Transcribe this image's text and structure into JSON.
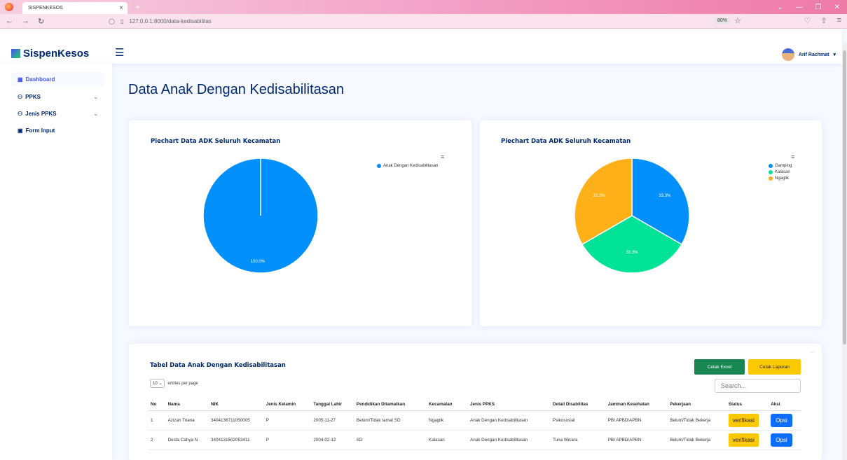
{
  "browser": {
    "tab_title": "SISPENKESOS",
    "url": "127.0.0.1:8000/data-kedisabilitas",
    "zoom": "80%"
  },
  "app": {
    "logo": "SispenKesos",
    "user_name": "Arif Rachmat"
  },
  "sidebar": {
    "items": [
      {
        "label": "Dashboard"
      },
      {
        "label": "PPKS"
      },
      {
        "label": "Jenis PPKS"
      },
      {
        "label": "Form Input"
      }
    ]
  },
  "page": {
    "title": "Data Anak Dengan Kedisabilitasan"
  },
  "chart_data": [
    {
      "type": "pie",
      "title": "Piechart Data ADK Seluruh Kecamatan",
      "categories": [
        "Anak Dengan Kedisabilitasan"
      ],
      "values": [
        100.0
      ],
      "labels": [
        "100.0%"
      ],
      "colors": [
        "#008ffb"
      ],
      "legend": "top-right"
    },
    {
      "type": "pie",
      "title": "Piechart Data ADK Seluruh Kecamatan",
      "categories": [
        "Gamping",
        "Kalasan",
        "Ngaglik"
      ],
      "values": [
        33.3,
        33.3,
        33.3
      ],
      "labels": [
        "33.3%",
        "33.3%",
        "33.3%"
      ],
      "colors": [
        "#008ffb",
        "#00e396",
        "#feb019"
      ],
      "legend": "top-right"
    }
  ],
  "table_card": {
    "title": "Tabel Data Anak Dengan Kedisabilitasan",
    "btn_excel": "Cetak Excel",
    "btn_laporan": "Cetak Laporan",
    "entries_value": "10",
    "entries_label": "entries per page",
    "search_placeholder": "Search...",
    "columns": [
      "No",
      "Nama",
      "NIK",
      "Jenis Kelamin",
      "Tanggal Lahir",
      "Pendidikan Ditamatkan",
      "Kecamatan",
      "Jenis PPKS",
      "Detail Disabilitas",
      "Jaminan Kesehatan",
      "Pekerjaan",
      "Status",
      "Aksi"
    ],
    "rows": [
      [
        "1",
        "Azizah Triana",
        "3404136711050005",
        "P",
        "2005-11-27",
        "Belum/Tidak tamat SD",
        "Ngaglik",
        "Anak Dengan Kedisabilitasan",
        "Psikososial",
        "PBI APBD/APBN",
        "Belum/Tidak Bekerja",
        "verifikasi",
        "Opsi"
      ],
      [
        "2",
        "Desta Cahya N",
        "3404131502053411",
        "P",
        "2004-02-12",
        "SD",
        "Kalasan",
        "Anak Dengan Kedisabilitasan",
        "Tuna Wicara",
        "PBI APBD/APBN",
        "Belum/Tidak Bekerja",
        "verifikasi",
        "Opsi"
      ]
    ]
  }
}
